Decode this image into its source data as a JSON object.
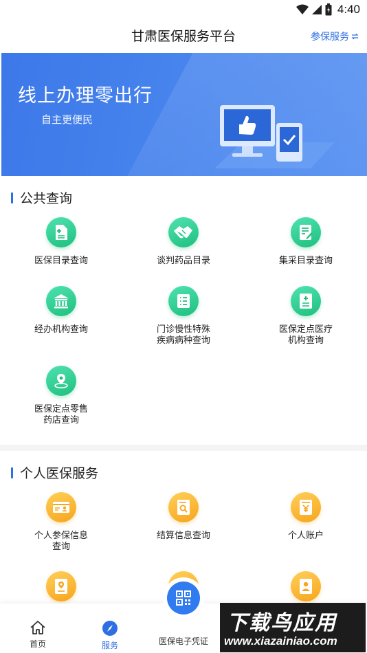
{
  "status_bar": {
    "time": "4:40"
  },
  "header": {
    "title": "甘肃医保服务平台",
    "action_label": "参保服务"
  },
  "banner": {
    "title": "线上办理零出行",
    "subtitle": "自主更便民"
  },
  "public_query": {
    "title": "公共查询",
    "items": [
      {
        "label": "医保目录查询",
        "icon": "document-icon"
      },
      {
        "label": "谈判药品目录",
        "icon": "handshake-icon"
      },
      {
        "label": "集采目录查询",
        "icon": "edit-document-icon"
      },
      {
        "label": "经办机构查询",
        "icon": "institution-icon"
      },
      {
        "label": "门诊慢性特殊\n疾病病种查询",
        "icon": "list-icon"
      },
      {
        "label": "医保定点医疗\n机构查询",
        "icon": "medical-record-icon"
      },
      {
        "label": "医保定点零售\n药店查询",
        "icon": "location-icon"
      }
    ]
  },
  "personal_service": {
    "title": "个人医保服务",
    "items": [
      {
        "label": "个人参保信息\n查询",
        "icon": "id-card-icon"
      },
      {
        "label": "结算信息查询",
        "icon": "search-document-icon"
      },
      {
        "label": "个人账户",
        "icon": "yuan-icon"
      },
      {
        "label": "",
        "icon": "location-card-icon"
      },
      {
        "label": "",
        "icon": "document-icon"
      },
      {
        "label": "",
        "icon": "person-card-icon"
      }
    ]
  },
  "bottom_nav": {
    "home": "首页",
    "service": "服务",
    "center": "医保电子凭证"
  },
  "watermark": {
    "top": "下载鸟应用",
    "bottom": "www.xiazainiao.com"
  },
  "colors": {
    "accent": "#2f6fe4",
    "green": "#1fbf7e",
    "orange": "#f7a51c"
  }
}
